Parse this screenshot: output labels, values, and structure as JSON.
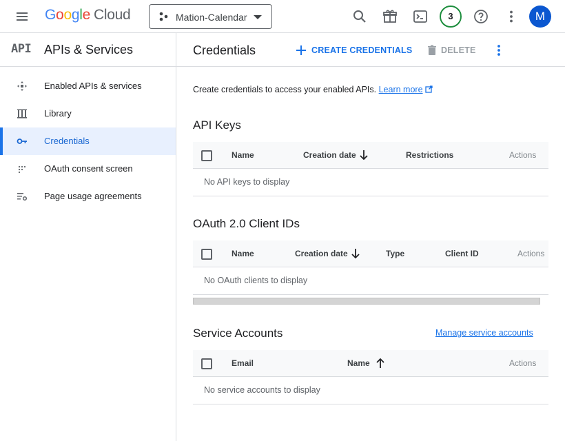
{
  "topbar": {
    "logo_google": "Google",
    "logo_cloud": "Cloud",
    "project_name": "Mation-Calendar",
    "notification_count": "3",
    "avatar_initial": "M",
    "icons": [
      "menu-icon",
      "search-icon",
      "gift-icon",
      "terminal-icon",
      "help-icon",
      "more-vert-icon"
    ]
  },
  "sidenav": {
    "api_logo": "API",
    "title": "APIs & Services",
    "items": [
      {
        "label": "Enabled APIs & services",
        "icon": "diamond-arrows-icon",
        "active": false
      },
      {
        "label": "Library",
        "icon": "library-icon",
        "active": false
      },
      {
        "label": "Credentials",
        "icon": "key-icon",
        "active": true
      },
      {
        "label": "OAuth consent screen",
        "icon": "dots-grid-icon",
        "active": false
      },
      {
        "label": "Page usage agreements",
        "icon": "list-settings-icon",
        "active": false
      }
    ]
  },
  "main": {
    "title": "Credentials",
    "create_label": "CREATE CREDENTIALS",
    "delete_label": "DELETE",
    "intro_text": "Create credentials to access your enabled APIs.",
    "learn_more": "Learn more",
    "api_keys": {
      "title": "API Keys",
      "columns": [
        "Name",
        "Creation date",
        "Restrictions",
        "Actions"
      ],
      "empty": "No API keys to display"
    },
    "oauth": {
      "title": "OAuth 2.0 Client IDs",
      "columns": [
        "Name",
        "Creation date",
        "Type",
        "Client ID",
        "Actions"
      ],
      "empty": "No OAuth clients to display"
    },
    "service_accounts": {
      "title": "Service Accounts",
      "manage_link": "Manage service accounts",
      "columns": [
        "Email",
        "Name",
        "Actions"
      ],
      "empty": "No service accounts to display"
    }
  },
  "colors": {
    "accent": "#1a73e8",
    "active_bg": "#e8f0fe",
    "badge_ring": "#1e8e3e",
    "avatar": "#0b57d0"
  }
}
